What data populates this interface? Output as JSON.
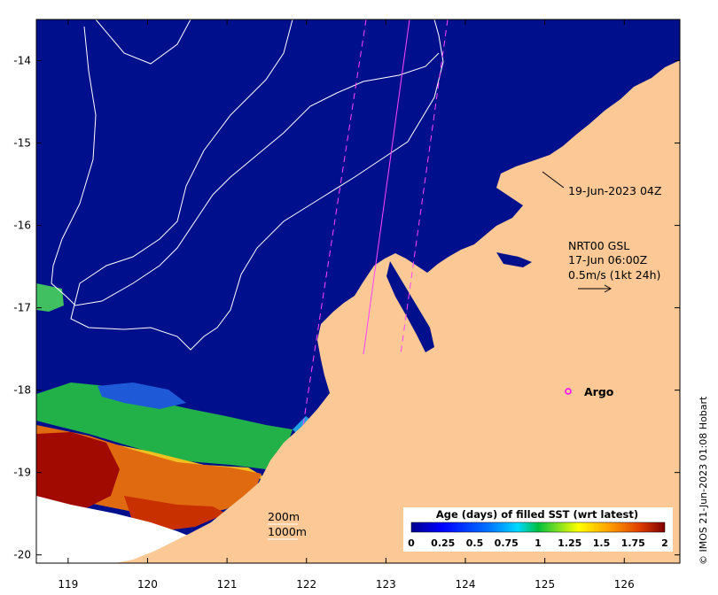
{
  "map": {
    "y_ticks": [
      "-14",
      "-15",
      "-16",
      "-17",
      "-18",
      "-19",
      "-20"
    ],
    "x_ticks": [
      "119",
      "120",
      "121",
      "122",
      "123",
      "124",
      "125",
      "126"
    ],
    "lon_range": [
      118.6,
      126.7
    ],
    "lat_range": [
      -20.1,
      -13.5
    ]
  },
  "annotations": {
    "track_time": "19-Jun-2023 04Z",
    "current_line1": "NRT00 GSL",
    "current_line2": "17-Jun 06:00Z",
    "current_line3": "0.5m/s (1kt 24h)",
    "argo_label": "Argo",
    "contour_200": "200m",
    "contour_1000": "1000m",
    "credit": "© IMOS 21-Jun-2023 01:08 Hobart"
  },
  "colorbar": {
    "title": "Age (days) of filled SST (wrt latest)",
    "labels": [
      "0",
      "0.25",
      "0.5",
      "0.75",
      "1",
      "1.25",
      "1.5",
      "1.75",
      "2"
    ],
    "range": [
      0,
      2
    ]
  },
  "colors": {
    "ocean": "#00108c",
    "land": "#fcc895",
    "no_data": "#ffffff",
    "green": "#22b048",
    "orange": "#e06a10",
    "dark_red": "#a00a00",
    "swath_line": "#ff44ff",
    "argo": "#ff00ff"
  }
}
